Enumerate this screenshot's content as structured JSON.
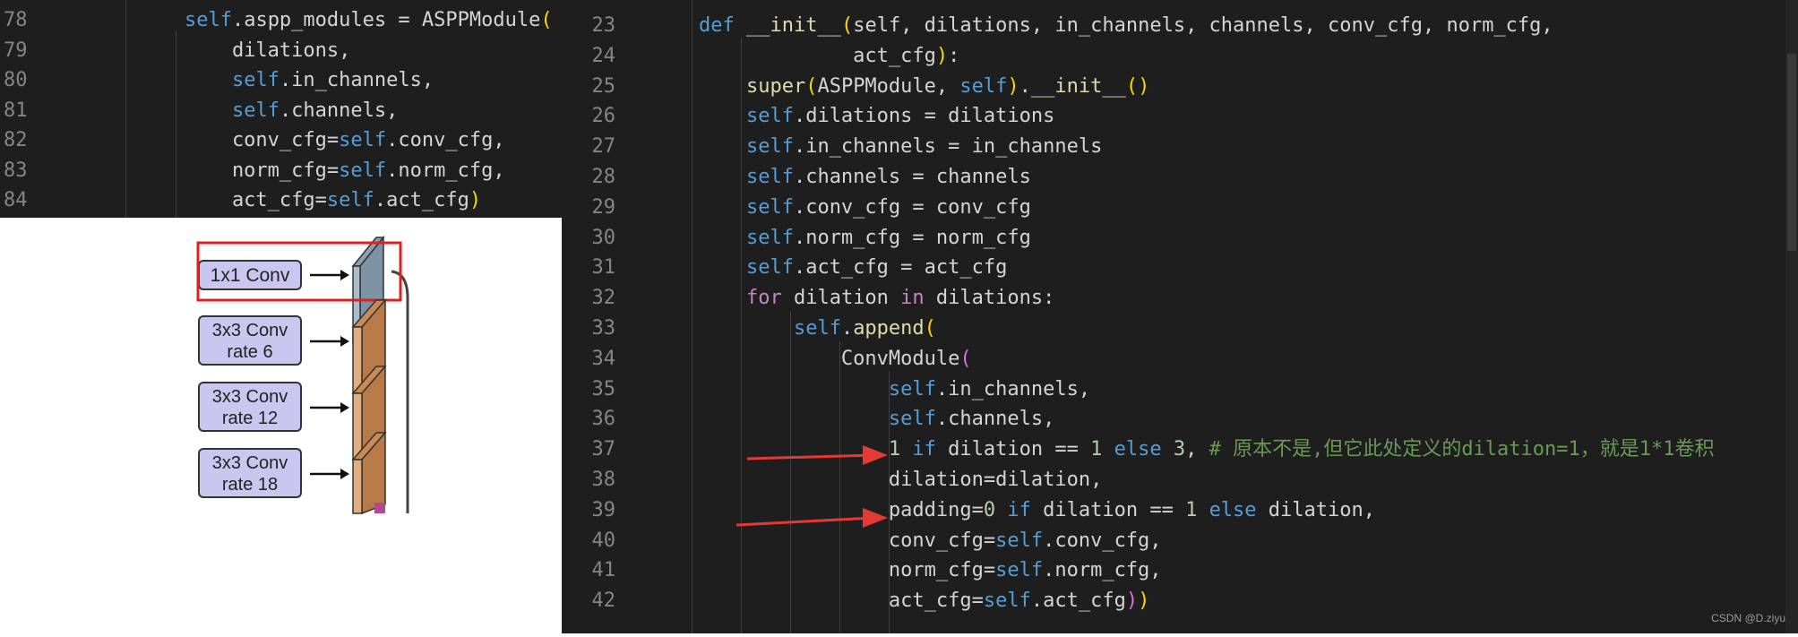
{
  "left_editor": {
    "lines": [
      {
        "n": "78",
        "tokens": [
          [
            "pl",
            "        "
          ],
          [
            "kw",
            "self"
          ],
          [
            "pl",
            ".aspp_modules = ASPPModule"
          ],
          [
            "b1",
            "("
          ]
        ]
      },
      {
        "n": "79",
        "tokens": [
          [
            "pl",
            "            dilations,"
          ]
        ]
      },
      {
        "n": "80",
        "tokens": [
          [
            "pl",
            "            "
          ],
          [
            "kw",
            "self"
          ],
          [
            "pl",
            ".in_channels,"
          ]
        ]
      },
      {
        "n": "81",
        "tokens": [
          [
            "pl",
            "            "
          ],
          [
            "kw",
            "self"
          ],
          [
            "pl",
            ".channels,"
          ]
        ]
      },
      {
        "n": "82",
        "tokens": [
          [
            "pl",
            "            conv_cfg="
          ],
          [
            "kw",
            "self"
          ],
          [
            "pl",
            ".conv_cfg,"
          ]
        ]
      },
      {
        "n": "83",
        "tokens": [
          [
            "pl",
            "            norm_cfg="
          ],
          [
            "kw",
            "self"
          ],
          [
            "pl",
            ".norm_cfg,"
          ]
        ]
      },
      {
        "n": "84",
        "tokens": [
          [
            "pl",
            "            act_cfg="
          ],
          [
            "kw",
            "self"
          ],
          [
            "pl",
            ".act_cfg"
          ],
          [
            "b1",
            ")"
          ]
        ]
      }
    ]
  },
  "right_editor": {
    "lines": [
      {
        "n": "23",
        "tokens": [
          [
            "pl",
            "    "
          ],
          [
            "kw",
            "def"
          ],
          [
            "pl",
            " "
          ],
          [
            "fn",
            "__init__"
          ],
          [
            "b1",
            "("
          ],
          [
            "pl",
            "self, dilations, in_channels, channels, conv_cfg, norm_cfg,"
          ]
        ]
      },
      {
        "n": "24",
        "tokens": [
          [
            "pl",
            "                 act_cfg"
          ],
          [
            "b1",
            ")"
          ],
          [
            "pl",
            ":"
          ]
        ]
      },
      {
        "n": "25",
        "tokens": [
          [
            "pl",
            "        "
          ],
          [
            "fn",
            "super"
          ],
          [
            "b1",
            "("
          ],
          [
            "pl",
            "ASPPModule, "
          ],
          [
            "kw",
            "self"
          ],
          [
            "b1",
            ")"
          ],
          [
            "pl",
            "."
          ],
          [
            "fn",
            "__init__"
          ],
          [
            "b1",
            "()"
          ]
        ]
      },
      {
        "n": "26",
        "tokens": [
          [
            "pl",
            "        "
          ],
          [
            "kw",
            "self"
          ],
          [
            "pl",
            ".dilations = dilations"
          ]
        ]
      },
      {
        "n": "27",
        "tokens": [
          [
            "pl",
            "        "
          ],
          [
            "kw",
            "self"
          ],
          [
            "pl",
            ".in_channels = in_channels"
          ]
        ]
      },
      {
        "n": "28",
        "tokens": [
          [
            "pl",
            "        "
          ],
          [
            "kw",
            "self"
          ],
          [
            "pl",
            ".channels = channels"
          ]
        ]
      },
      {
        "n": "29",
        "tokens": [
          [
            "pl",
            "        "
          ],
          [
            "kw",
            "self"
          ],
          [
            "pl",
            ".conv_cfg = conv_cfg"
          ]
        ]
      },
      {
        "n": "30",
        "tokens": [
          [
            "pl",
            "        "
          ],
          [
            "kw",
            "self"
          ],
          [
            "pl",
            ".norm_cfg = norm_cfg"
          ]
        ]
      },
      {
        "n": "31",
        "tokens": [
          [
            "pl",
            "        "
          ],
          [
            "kw",
            "self"
          ],
          [
            "pl",
            ".act_cfg = act_cfg"
          ]
        ]
      },
      {
        "n": "32",
        "tokens": [
          [
            "pl",
            "        "
          ],
          [
            "ctrl",
            "for"
          ],
          [
            "pl",
            " dilation "
          ],
          [
            "ctrl",
            "in"
          ],
          [
            "pl",
            " dilations:"
          ]
        ]
      },
      {
        "n": "33",
        "tokens": [
          [
            "pl",
            "            "
          ],
          [
            "kw",
            "self"
          ],
          [
            "pl",
            "."
          ],
          [
            "fn",
            "append"
          ],
          [
            "b1",
            "("
          ]
        ]
      },
      {
        "n": "34",
        "tokens": [
          [
            "pl",
            "                ConvModule"
          ],
          [
            "b2",
            "("
          ]
        ]
      },
      {
        "n": "35",
        "tokens": [
          [
            "pl",
            "                    "
          ],
          [
            "kw",
            "self"
          ],
          [
            "pl",
            ".in_channels,"
          ]
        ]
      },
      {
        "n": "36",
        "tokens": [
          [
            "pl",
            "                    "
          ],
          [
            "kw",
            "self"
          ],
          [
            "pl",
            ".channels,"
          ]
        ]
      },
      {
        "n": "37",
        "tokens": [
          [
            "pl",
            "                    "
          ],
          [
            "num",
            "1"
          ],
          [
            "pl",
            " "
          ],
          [
            "kw",
            "if"
          ],
          [
            "pl",
            " dilation == "
          ],
          [
            "num",
            "1"
          ],
          [
            "pl",
            " "
          ],
          [
            "kw",
            "else"
          ],
          [
            "pl",
            " "
          ],
          [
            "num",
            "3"
          ],
          [
            "pl",
            ", "
          ],
          [
            "cmt",
            "# 原本不是,但它此处定义的dilation=1，就是1*1卷积"
          ]
        ]
      },
      {
        "n": "38",
        "tokens": [
          [
            "pl",
            "                    dilation=dilation,"
          ]
        ]
      },
      {
        "n": "39",
        "tokens": [
          [
            "pl",
            "                    padding="
          ],
          [
            "num",
            "0"
          ],
          [
            "pl",
            " "
          ],
          [
            "kw",
            "if"
          ],
          [
            "pl",
            " dilation == "
          ],
          [
            "num",
            "1"
          ],
          [
            "pl",
            " "
          ],
          [
            "kw",
            "else"
          ],
          [
            "pl",
            " dilation,"
          ]
        ]
      },
      {
        "n": "40",
        "tokens": [
          [
            "pl",
            "                    conv_cfg="
          ],
          [
            "kw",
            "self"
          ],
          [
            "pl",
            ".conv_cfg,"
          ]
        ]
      },
      {
        "n": "41",
        "tokens": [
          [
            "pl",
            "                    norm_cfg="
          ],
          [
            "kw",
            "self"
          ],
          [
            "pl",
            ".norm_cfg,"
          ]
        ]
      },
      {
        "n": "42",
        "tokens": [
          [
            "pl",
            "                    act_cfg="
          ],
          [
            "kw",
            "self"
          ],
          [
            "pl",
            ".act_cfg"
          ],
          [
            "b2",
            ")"
          ],
          [
            "b1",
            ")"
          ]
        ]
      }
    ]
  },
  "figure": {
    "boxes": [
      {
        "line1": "1x1 Conv",
        "line2": ""
      },
      {
        "line1": "3x3 Conv",
        "line2": "rate 6"
      },
      {
        "line1": "3x3 Conv",
        "line2": "rate 12"
      },
      {
        "line1": "3x3 Conv",
        "line2": "rate 18"
      }
    ]
  },
  "colors": {
    "editor_bg": "#1e1e1e",
    "highlight_box": "#e02020",
    "annotation_arrow": "#e53935",
    "box_fill": "#c9c6ef",
    "block_1x1": "#a9bccb",
    "block_3x3": "#e3ad7e"
  },
  "watermark": "CSDN @D.ziyu"
}
